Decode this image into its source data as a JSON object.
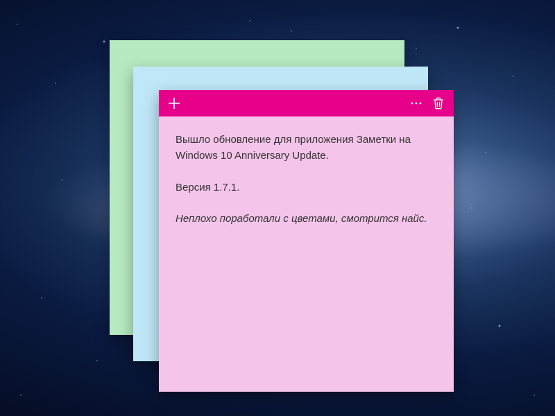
{
  "notes": {
    "green": {
      "color": "#b7eac1"
    },
    "blue": {
      "color": "#bfe7f7"
    },
    "pink": {
      "accent": "#e6008a",
      "background": "#f5c4ea",
      "body": {
        "line1": "Вышло обновление для приложения Заметки на Windows 10 Anniversary Update.",
        "line2": "Версия 1.7.1.",
        "line3": "Неплохо поработали с цветами, смотрится найс."
      }
    }
  }
}
